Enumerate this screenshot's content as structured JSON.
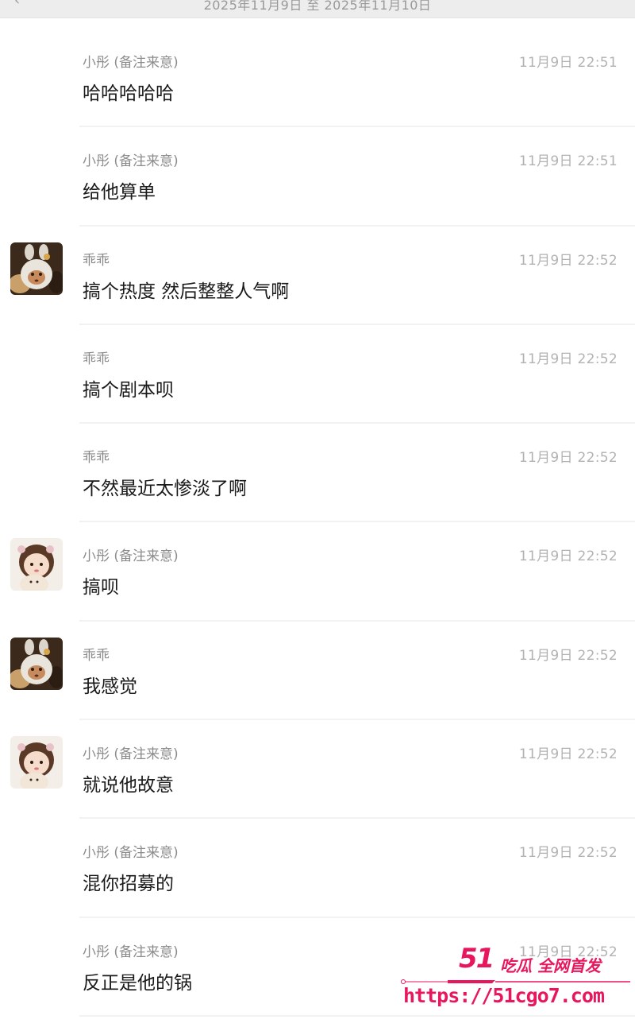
{
  "header": {
    "date_range": "2025年11月9日 至 2025年11月10日"
  },
  "messages": [
    {
      "sender": "小彤 (备注来意)",
      "time": "11月9日 22:51",
      "text": "哈哈哈哈哈",
      "avatar": "none"
    },
    {
      "sender": "小彤 (备注来意)",
      "time": "11月9日 22:51",
      "text": "给他算单",
      "avatar": "none"
    },
    {
      "sender": "乖乖",
      "time": "11月9日 22:52",
      "text": "搞个热度 然后整整人气啊",
      "avatar": "plush-toy-avatar"
    },
    {
      "sender": "乖乖",
      "time": "11月9日 22:52",
      "text": "搞个剧本呗",
      "avatar": "none"
    },
    {
      "sender": "乖乖",
      "time": "11月9日 22:52",
      "text": "不然最近太惨淡了啊",
      "avatar": "none"
    },
    {
      "sender": "小彤 (备注来意)",
      "time": "11月9日 22:52",
      "text": "搞呗",
      "avatar": "girl-avatar"
    },
    {
      "sender": "乖乖",
      "time": "11月9日 22:52",
      "text": "我感觉",
      "avatar": "plush-toy-avatar"
    },
    {
      "sender": "小彤 (备注来意)",
      "time": "11月9日 22:52",
      "text": "就说他故意",
      "avatar": "girl-avatar"
    },
    {
      "sender": "小彤 (备注来意)",
      "time": "11月9日 22:52",
      "text": "混你招募的",
      "avatar": "none"
    },
    {
      "sender": "小彤 (备注来意)",
      "time": "11月9日 22:52",
      "text": "反正是他的锅",
      "avatar": "none"
    }
  ],
  "watermark": {
    "brand": "51",
    "tagline": "吃瓜 全网首发",
    "url": "https://51cgo7.com"
  }
}
